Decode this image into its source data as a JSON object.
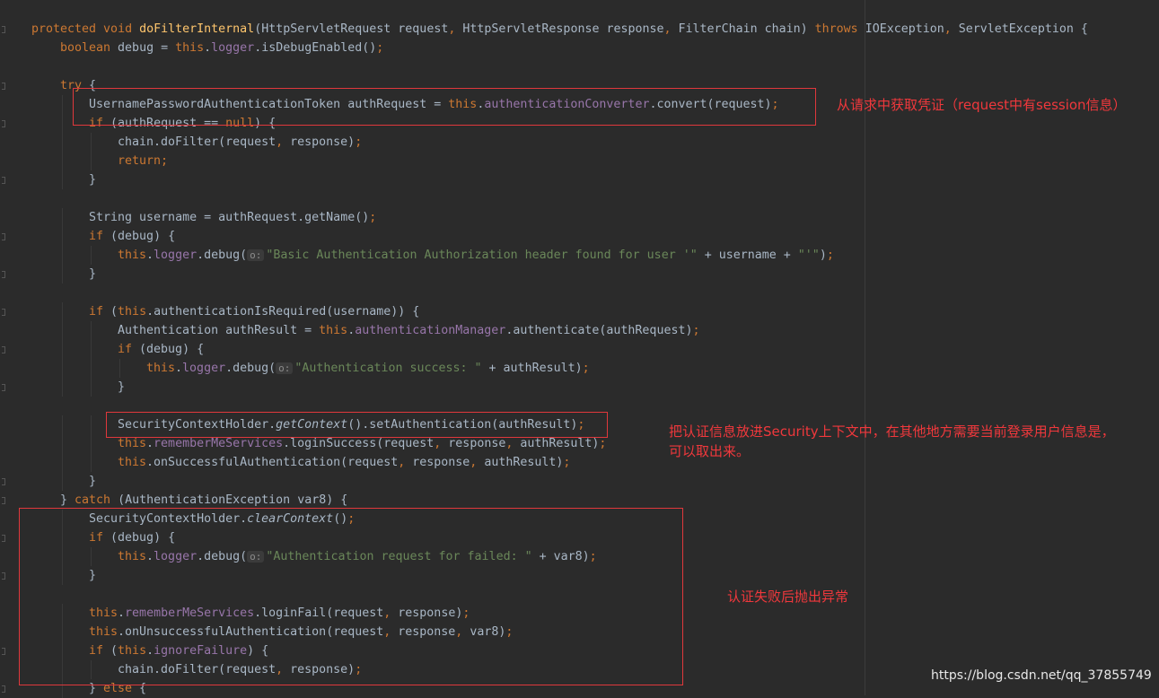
{
  "colors": {
    "background": "#2b2b2b",
    "keyword": "#cc7832",
    "method": "#ffc66d",
    "field": "#9876aa",
    "string": "#6a8759",
    "text": "#a9b7c6",
    "annotation": "#e0383c"
  },
  "code": [
    {
      "indent": 0,
      "tokens": [
        [
          "k",
          "protected void "
        ],
        [
          "f",
          "doFilterInternal"
        ],
        [
          "p",
          "(HttpServletRequest request"
        ],
        [
          "k",
          ", "
        ],
        [
          "p",
          "HttpServletResponse response"
        ],
        [
          "k",
          ", "
        ],
        [
          "p",
          "FilterChain chain) "
        ],
        [
          "k",
          "throws "
        ],
        [
          "p",
          "IOException"
        ],
        [
          "k",
          ", "
        ],
        [
          "p",
          "ServletException {"
        ]
      ]
    },
    {
      "indent": 1,
      "tokens": [
        [
          "k",
          "boolean "
        ],
        [
          "p",
          "debug = "
        ],
        [
          "k",
          "this"
        ],
        [
          "p",
          "."
        ],
        [
          "v",
          "logger"
        ],
        [
          "p",
          ".isDebugEnabled()"
        ],
        [
          "k",
          ";"
        ]
      ]
    },
    {
      "indent": 0,
      "tokens": []
    },
    {
      "indent": 1,
      "tokens": [
        [
          "k",
          "try "
        ],
        [
          "p",
          "{"
        ]
      ]
    },
    {
      "indent": 2,
      "tokens": [
        [
          "p",
          "UsernamePasswordAuthenticationToken authRequest = "
        ],
        [
          "k",
          "this"
        ],
        [
          "p",
          "."
        ],
        [
          "v",
          "authenticationConverter"
        ],
        [
          "p",
          ".convert(request)"
        ],
        [
          "k",
          ";"
        ]
      ]
    },
    {
      "indent": 2,
      "tokens": [
        [
          "k",
          "if "
        ],
        [
          "p",
          "(authRequest == "
        ],
        [
          "k",
          "null"
        ],
        [
          "p",
          ") {"
        ]
      ]
    },
    {
      "indent": 3,
      "tokens": [
        [
          "p",
          "chain.doFilter(request"
        ],
        [
          "k",
          ", "
        ],
        [
          "p",
          "response)"
        ],
        [
          "k",
          ";"
        ]
      ]
    },
    {
      "indent": 3,
      "tokens": [
        [
          "k",
          "return;"
        ]
      ]
    },
    {
      "indent": 2,
      "tokens": [
        [
          "p",
          "}"
        ]
      ]
    },
    {
      "indent": 0,
      "tokens": []
    },
    {
      "indent": 2,
      "tokens": [
        [
          "p",
          "String username = authRequest.getName()"
        ],
        [
          "k",
          ";"
        ]
      ]
    },
    {
      "indent": 2,
      "tokens": [
        [
          "k",
          "if "
        ],
        [
          "p",
          "(debug) {"
        ]
      ]
    },
    {
      "indent": 3,
      "tokens": [
        [
          "k",
          "this"
        ],
        [
          "p",
          "."
        ],
        [
          "v",
          "logger"
        ],
        [
          "p",
          ".debug("
        ],
        [
          "h",
          "o:"
        ],
        [
          "s",
          "\"Basic Authentication Authorization header found for user '\""
        ],
        [
          "p",
          " + username + "
        ],
        [
          "s",
          "\"'\""
        ],
        [
          "p",
          ")"
        ],
        [
          "k",
          ";"
        ]
      ]
    },
    {
      "indent": 2,
      "tokens": [
        [
          "p",
          "}"
        ]
      ]
    },
    {
      "indent": 0,
      "tokens": []
    },
    {
      "indent": 2,
      "tokens": [
        [
          "k",
          "if "
        ],
        [
          "p",
          "("
        ],
        [
          "k",
          "this"
        ],
        [
          "p",
          ".authenticationIsRequired(username)) {"
        ]
      ]
    },
    {
      "indent": 3,
      "tokens": [
        [
          "p",
          "Authentication authResult = "
        ],
        [
          "k",
          "this"
        ],
        [
          "p",
          "."
        ],
        [
          "v",
          "authenticationManager"
        ],
        [
          "p",
          ".authenticate(authRequest)"
        ],
        [
          "k",
          ";"
        ]
      ]
    },
    {
      "indent": 3,
      "tokens": [
        [
          "k",
          "if "
        ],
        [
          "p",
          "(debug) {"
        ]
      ]
    },
    {
      "indent": 4,
      "tokens": [
        [
          "k",
          "this"
        ],
        [
          "p",
          "."
        ],
        [
          "v",
          "logger"
        ],
        [
          "p",
          ".debug("
        ],
        [
          "h",
          "o:"
        ],
        [
          "s",
          "\"Authentication success: \""
        ],
        [
          "p",
          " + authResult)"
        ],
        [
          "k",
          ";"
        ]
      ]
    },
    {
      "indent": 3,
      "tokens": [
        [
          "p",
          "}"
        ]
      ]
    },
    {
      "indent": 0,
      "tokens": []
    },
    {
      "indent": 3,
      "tokens": [
        [
          "p",
          "SecurityContextHolder."
        ],
        [
          "i",
          "getContext"
        ],
        [
          "p",
          "().setAuthentication(authResult)"
        ],
        [
          "k",
          ";"
        ]
      ]
    },
    {
      "indent": 3,
      "tokens": [
        [
          "k",
          "this"
        ],
        [
          "p",
          "."
        ],
        [
          "v",
          "rememberMeServices"
        ],
        [
          "p",
          ".loginSuccess(request"
        ],
        [
          "k",
          ", "
        ],
        [
          "p",
          "response"
        ],
        [
          "k",
          ", "
        ],
        [
          "p",
          "authResult)"
        ],
        [
          "k",
          ";"
        ]
      ]
    },
    {
      "indent": 3,
      "tokens": [
        [
          "k",
          "this"
        ],
        [
          "p",
          ".onSuccessfulAuthentication(request"
        ],
        [
          "k",
          ", "
        ],
        [
          "p",
          "response"
        ],
        [
          "k",
          ", "
        ],
        [
          "p",
          "authResult)"
        ],
        [
          "k",
          ";"
        ]
      ]
    },
    {
      "indent": 2,
      "tokens": [
        [
          "p",
          "}"
        ]
      ]
    },
    {
      "indent": 1,
      "tokens": [
        [
          "p",
          "} "
        ],
        [
          "k",
          "catch "
        ],
        [
          "p",
          "(AuthenticationException var8) {"
        ]
      ]
    },
    {
      "indent": 2,
      "tokens": [
        [
          "p",
          "SecurityContextHolder."
        ],
        [
          "i",
          "clearContext"
        ],
        [
          "p",
          "()"
        ],
        [
          "k",
          ";"
        ]
      ]
    },
    {
      "indent": 2,
      "tokens": [
        [
          "k",
          "if "
        ],
        [
          "p",
          "(debug) {"
        ]
      ]
    },
    {
      "indent": 3,
      "tokens": [
        [
          "k",
          "this"
        ],
        [
          "p",
          "."
        ],
        [
          "v",
          "logger"
        ],
        [
          "p",
          ".debug("
        ],
        [
          "h",
          "o:"
        ],
        [
          "s",
          "\"Authentication request for failed: \""
        ],
        [
          "p",
          " + var8)"
        ],
        [
          "k",
          ";"
        ]
      ]
    },
    {
      "indent": 2,
      "tokens": [
        [
          "p",
          "}"
        ]
      ]
    },
    {
      "indent": 0,
      "tokens": []
    },
    {
      "indent": 2,
      "tokens": [
        [
          "k",
          "this"
        ],
        [
          "p",
          "."
        ],
        [
          "v",
          "rememberMeServices"
        ],
        [
          "p",
          ".loginFail(request"
        ],
        [
          "k",
          ", "
        ],
        [
          "p",
          "response)"
        ],
        [
          "k",
          ";"
        ]
      ]
    },
    {
      "indent": 2,
      "tokens": [
        [
          "k",
          "this"
        ],
        [
          "p",
          ".onUnsuccessfulAuthentication(request"
        ],
        [
          "k",
          ", "
        ],
        [
          "p",
          "response"
        ],
        [
          "k",
          ", "
        ],
        [
          "p",
          "var8)"
        ],
        [
          "k",
          ";"
        ]
      ]
    },
    {
      "indent": 2,
      "tokens": [
        [
          "k",
          "if "
        ],
        [
          "p",
          "("
        ],
        [
          "k",
          "this"
        ],
        [
          "p",
          "."
        ],
        [
          "v",
          "ignoreFailure"
        ],
        [
          "p",
          ") {"
        ]
      ]
    },
    {
      "indent": 3,
      "tokens": [
        [
          "p",
          "chain.doFilter(request"
        ],
        [
          "k",
          ", "
        ],
        [
          "p",
          "response)"
        ],
        [
          "k",
          ";"
        ]
      ]
    },
    {
      "indent": 2,
      "tokens": [
        [
          "p",
          "} "
        ],
        [
          "k",
          "else "
        ],
        [
          "p",
          "{"
        ]
      ]
    }
  ],
  "annotations": {
    "credentials_note": "从请求中获取凭证（request中有session信息）",
    "context_note_line1": "把认证信息放进Security上下文中，在其他地方需要当前登录用户信息是，",
    "context_note_line2": "可以取出来。",
    "failure_note": "认证失败后抛出异常"
  },
  "watermark": "https://blog.csdn.net/qq_37855749"
}
